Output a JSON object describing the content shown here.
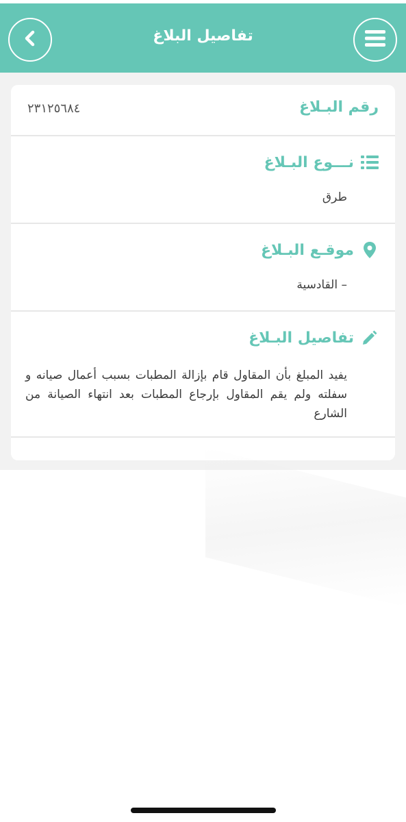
{
  "header": {
    "title": "تفاصيل البلاغ",
    "menu_icon": "hamburger-icon",
    "back_icon": "chevron-left-icon"
  },
  "report": {
    "number_label": "رقم البـلاغ",
    "number_value": "٢٣١٢٥٦٨٤",
    "type_label": "نـــوع البـلاغ",
    "type_icon": "list-icon",
    "type_value": "طرق",
    "location_label": "موقـع البـلاغ",
    "location_icon": "map-pin-icon",
    "location_value": "– القادسية",
    "details_label": "تفاصيل البـلاغ",
    "details_icon": "pencil-icon",
    "details_value": "يفيد المبلغ بأن المقاول قام بإزالة المطبات بسبب أعمال صيانه و سفلته ولم يقم المقاول بإرجاع المطبات بعد انتهاء الصيانة من الشارع"
  },
  "colors": {
    "accent": "#65c6b6",
    "background": "#f2f2f2",
    "card": "#ffffff",
    "text": "#3e3e3e"
  }
}
